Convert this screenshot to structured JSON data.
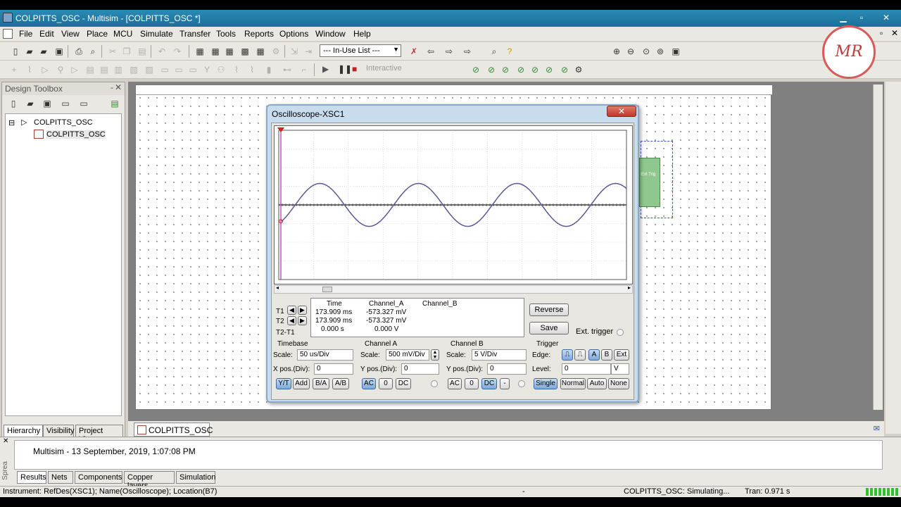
{
  "window": {
    "title": "COLPITTS_OSC - Multisim - [COLPITTS_OSC *]"
  },
  "menu": [
    "File",
    "Edit",
    "View",
    "Place",
    "MCU",
    "Simulate",
    "Transfer",
    "Tools",
    "Reports",
    "Options",
    "Window",
    "Help"
  ],
  "toolbar": {
    "in_use_list": "--- In-Use List ---",
    "interactive_label": "Interactive"
  },
  "logo": {
    "text": "MR"
  },
  "toolbox": {
    "title": "Design Toolbox",
    "tree": {
      "root": "COLPITTS_OSC",
      "child": "COLPITTS_OSC"
    },
    "tabs": [
      "Hierarchy",
      "Visibility",
      "Project View"
    ]
  },
  "oscilloscope": {
    "title": "Oscilloscope-XSC1",
    "cursors": {
      "headers": [
        "Time",
        "Channel_A",
        "Channel_B"
      ],
      "t1_label": "T1",
      "t2_label": "T2",
      "diff_label": "T2-T1",
      "t1": {
        "time": "173.909 ms",
        "channel_a": "-573.327 mV"
      },
      "t2": {
        "time": "173.909 ms",
        "channel_a": "-573.327 mV"
      },
      "diff": {
        "time": "0.000 s",
        "channel_a": "0.000 V"
      }
    },
    "reverse_label": "Reverse",
    "save_label": "Save",
    "ext_trigger_label": "Ext. trigger",
    "timebase": {
      "title": "Timebase",
      "scale_label": "Scale:",
      "scale": "50 us/Div",
      "xpos_label": "X pos.(Div):",
      "xpos": "0",
      "buttons": [
        "Y/T",
        "Add",
        "B/A",
        "A/B"
      ]
    },
    "channel_a": {
      "title": "Channel A",
      "scale_label": "Scale:",
      "scale": "500 mV/Div",
      "ypos_label": "Y pos.(Div):",
      "ypos": "0",
      "buttons": [
        "AC",
        "0",
        "DC"
      ]
    },
    "channel_b": {
      "title": "Channel B",
      "scale_label": "Scale:",
      "scale": "5  V/Div",
      "ypos_label": "Y pos.(Div):",
      "ypos": "0",
      "buttons": [
        "AC",
        "0",
        "DC",
        "-"
      ]
    },
    "trigger": {
      "title": "Trigger",
      "edge_label": "Edge:",
      "edge_buttons": [
        "A",
        "B",
        "Ext"
      ],
      "level_label": "Level:",
      "level": "0",
      "level_unit": "V",
      "mode_buttons": [
        "Single",
        "Normal",
        "Auto",
        "None"
      ]
    },
    "waveform": {
      "amplitude_div": 1.15,
      "periods_visible": 3.5
    },
    "ext_trig_block": "Ext Trig"
  },
  "file_tab": "COLPITTS_OSC *",
  "spreadsheet": {
    "side_label": "Sprea",
    "message": "Multisim  -  13 September, 2019, 1:07:08 PM",
    "tabs": [
      "Results",
      "Nets",
      "Components",
      "Copper layers",
      "Simulation"
    ]
  },
  "status": {
    "left": "Instrument: RefDes(XSC1); Name(Oscilloscope); Location(B7)",
    "mid": "-",
    "sim": "COLPITTS_OSC: Simulating...",
    "tran": "Tran: 0.971 s"
  },
  "colors": {
    "trace": "#5a5a9a",
    "titlebar": "#1b6f96",
    "cursor": "#c020c0"
  }
}
